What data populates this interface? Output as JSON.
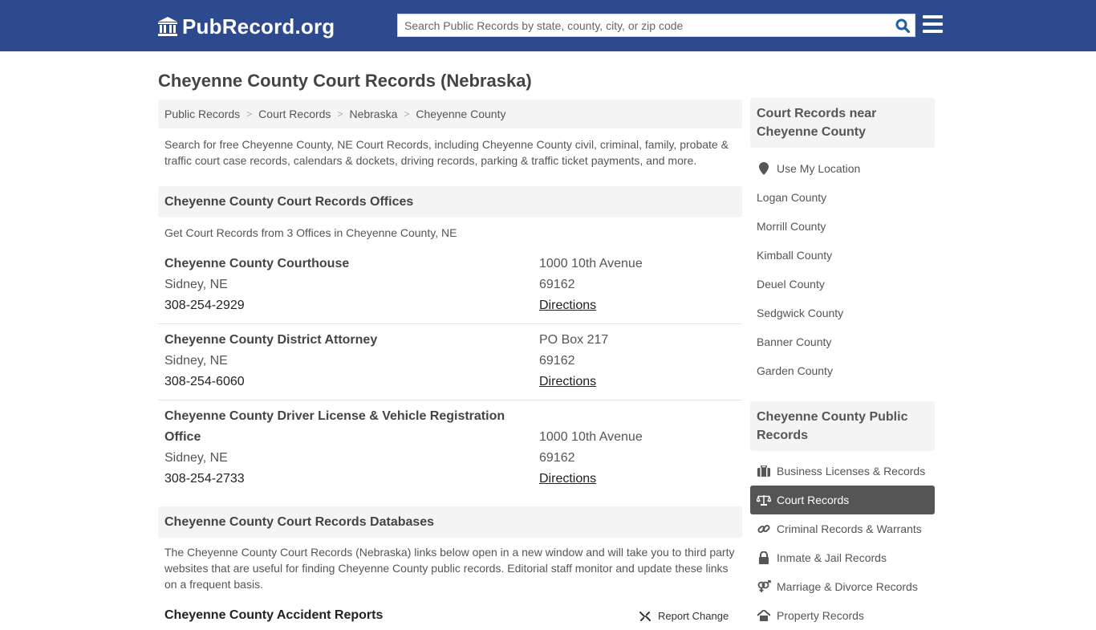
{
  "header": {
    "logo_text": "PubRecord.org",
    "search_placeholder": "Search Public Records by state, county, city, or zip code",
    "search_value": "",
    "colors": {
      "bar": "#2e4a8e",
      "search_icon": "#1f5fa8"
    }
  },
  "page": {
    "title": "Cheyenne County Court Records (Nebraska)",
    "breadcrumb": [
      "Public Records",
      "Court Records",
      "Nebraska",
      "Cheyenne County"
    ],
    "intro": "Search for free Cheyenne County, NE Court Records, including Cheyenne County civil, criminal, family, probate & traffic court case records, calendars & dockets, driving records, parking & traffic ticket payments, and more."
  },
  "offices_section": {
    "heading": "Cheyenne County Court Records Offices",
    "subtitle": "Get Court Records from 3 Offices in Cheyenne County, NE",
    "offices": [
      {
        "name": "Cheyenne County Courthouse",
        "city": "Sidney, NE",
        "phone": "308-254-2929",
        "address": "1000 10th Avenue",
        "zip": "69162",
        "directions": "Directions"
      },
      {
        "name": "Cheyenne County District Attorney",
        "city": "Sidney, NE",
        "phone": "308-254-6060",
        "address": "PO Box 217",
        "zip": "69162",
        "directions": "Directions"
      },
      {
        "name": "Cheyenne County Driver License & Vehicle Registration Office",
        "city": "Sidney, NE",
        "phone": "308-254-2733",
        "address": "1000 10th Avenue",
        "zip": "69162",
        "directions": "Directions"
      }
    ]
  },
  "databases_section": {
    "heading": "Cheyenne County Court Records Databases",
    "description": "The Cheyenne County Court Records (Nebraska) links below open in a new window and will take you to third party websites that are useful for finding Cheyenne County public records. Editorial staff monitor and update these links on a frequent basis.",
    "first_item_title": "Cheyenne County Accident Reports",
    "report_change": "Report Change"
  },
  "sidebar": {
    "nearby_heading": "Court Records near Cheyenne County",
    "use_location": "Use My Location",
    "nearby": [
      "Logan County",
      "Morrill County",
      "Kimball County",
      "Deuel County",
      "Sedgwick County",
      "Banner County",
      "Garden County"
    ],
    "public_heading": "Cheyenne County Public Records",
    "public_items": [
      {
        "label": "Business Licenses & Records",
        "icon": "briefcase-icon",
        "active": false
      },
      {
        "label": "Court Records",
        "icon": "balance-scale-icon",
        "active": true
      },
      {
        "label": "Criminal Records & Warrants",
        "icon": "link-icon",
        "active": false
      },
      {
        "label": "Inmate & Jail Records",
        "icon": "lock-icon",
        "active": false
      },
      {
        "label": "Marriage & Divorce Records",
        "icon": "venus-mars-icon",
        "active": false
      },
      {
        "label": "Property Records",
        "icon": "home-icon",
        "active": false
      }
    ]
  }
}
